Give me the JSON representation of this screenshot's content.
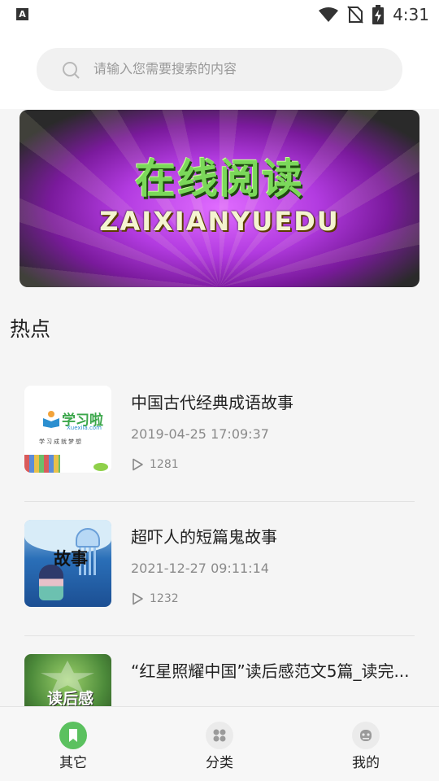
{
  "status_bar": {
    "time": "4:31",
    "badge": "A"
  },
  "search": {
    "placeholder": "请输入您需要搜索的内容"
  },
  "banner": {
    "title_cn": "在线阅读",
    "title_en": "ZAIXIANYUEDU"
  },
  "section": {
    "title": "热点"
  },
  "items": [
    {
      "title": "中国古代经典成语故事",
      "date": "2019-04-25 17:09:37",
      "count": "1281",
      "thumb": {
        "logo": "学习啦",
        "logo_sub": "Xuexila.com",
        "tagline": "学习成就梦想"
      }
    },
    {
      "title": "超吓人的短篇鬼故事",
      "date": "2021-12-27 09:11:14",
      "count": "1232",
      "thumb": {
        "word": "故事"
      }
    },
    {
      "title": "“红星照耀中国”读后感范文5篇_读完...",
      "date": "",
      "count": "",
      "thumb": {
        "word": "读后感"
      }
    }
  ],
  "tabs": [
    {
      "label": "其它",
      "icon": "bookmark-icon",
      "active": true
    },
    {
      "label": "分类",
      "icon": "grid-icon",
      "active": false
    },
    {
      "label": "我的",
      "icon": "robot-icon",
      "active": false
    }
  ],
  "colors": {
    "accent": "#5bc15f",
    "muted_text": "#8a8a8a"
  }
}
